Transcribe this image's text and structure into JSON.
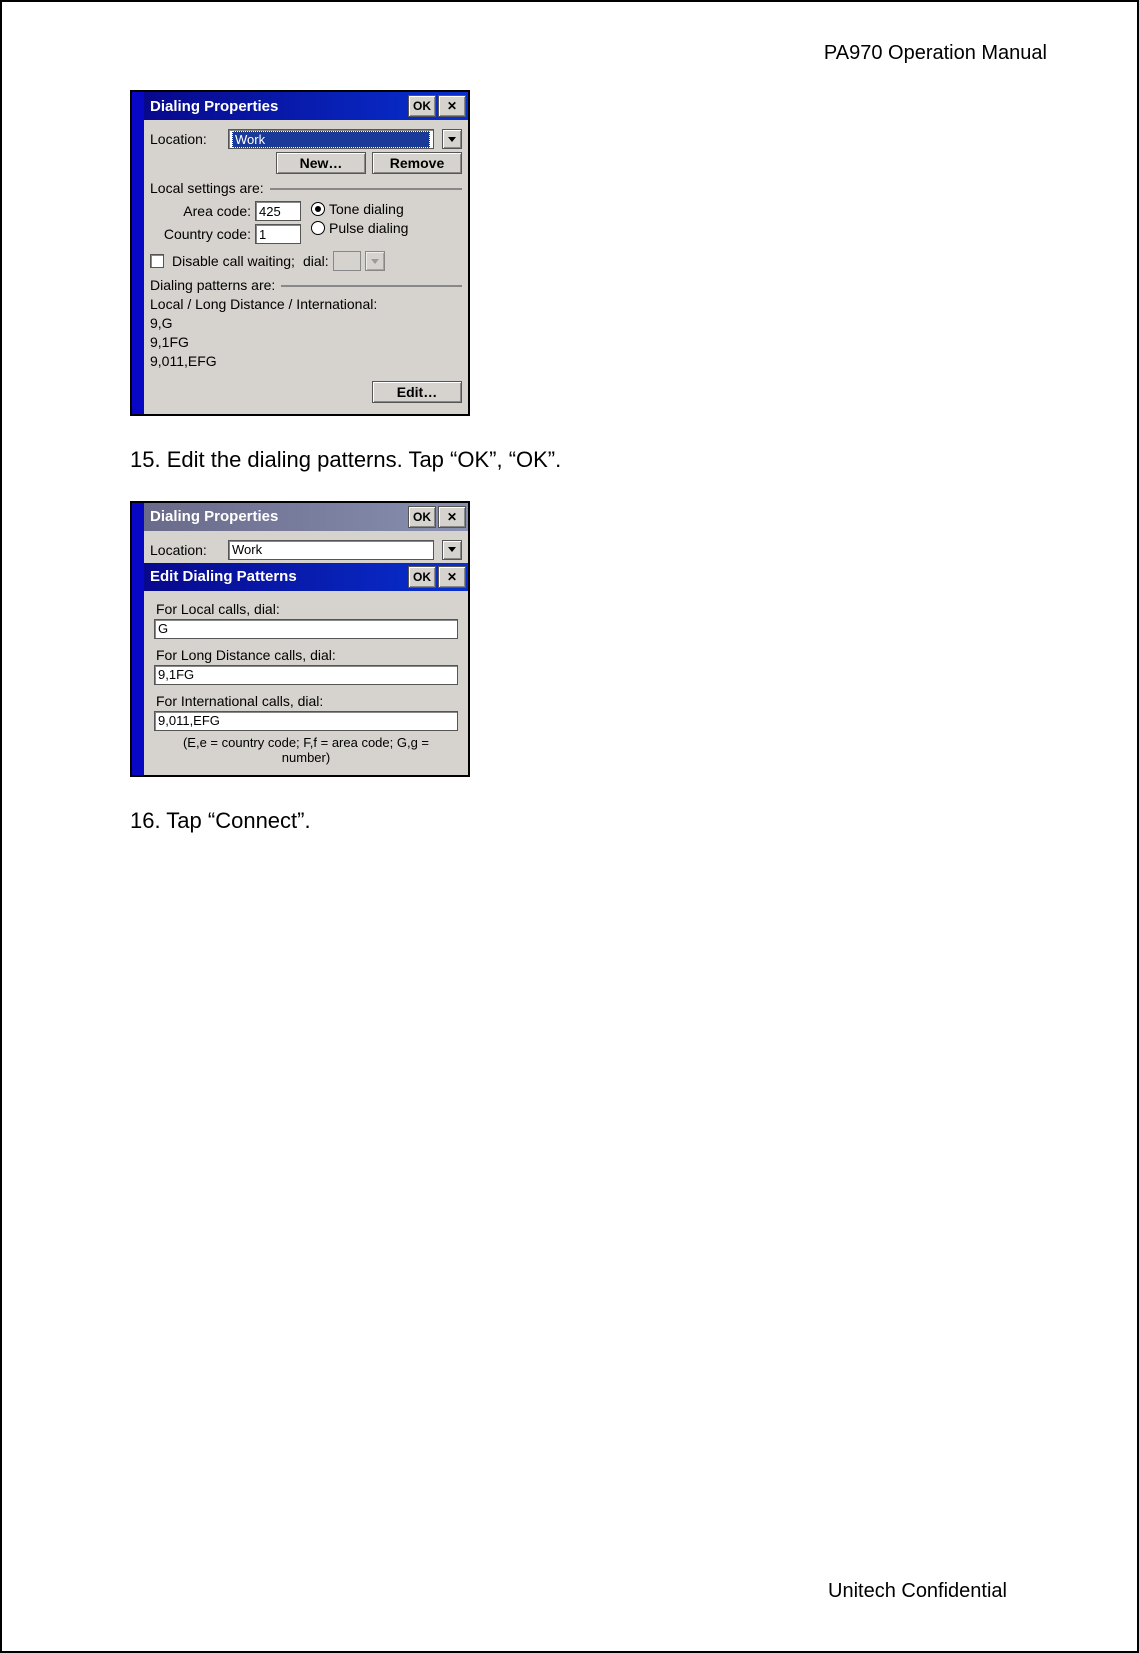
{
  "doc": {
    "header": "PA970 Operation Manual",
    "footer": "Unitech Confidential",
    "step15": "15. Edit the dialing patterns. Tap “OK”, “OK”.",
    "step16": "16. Tap “Connect”."
  },
  "dialog1": {
    "title": "Dialing Properties",
    "ok": "OK",
    "close": "✕",
    "location_label": "Location:",
    "location_value": "Work",
    "new_btn": "New…",
    "remove_btn": "Remove",
    "local_settings_label": "Local settings are:",
    "area_code_label": "Area code:",
    "area_code_value": "425",
    "country_code_label": "Country code:",
    "country_code_value": "1",
    "tone_label": "Tone dialing",
    "pulse_label": "Pulse dialing",
    "disable_call_waiting_label": "Disable call waiting;",
    "dial_label": "dial:",
    "patterns_label": "Dialing patterns are:",
    "patterns_sublabel": "Local / Long Distance / International:",
    "pattern_local": "9,G",
    "pattern_long": "9,1FG",
    "pattern_intl": "9,011,EFG",
    "edit_btn": "Edit…"
  },
  "dialog2": {
    "parent_title": "Dialing Properties",
    "parent_ok": "OK",
    "parent_close": "✕",
    "parent_location_label": "Location:",
    "parent_location_value": "Work",
    "child_title": "Edit Dialing Patterns",
    "child_ok": "OK",
    "child_close": "✕",
    "local_label": "For Local calls, dial:",
    "local_value": "G",
    "long_label": "For Long Distance calls, dial:",
    "long_value": "9,1FG",
    "intl_label": "For International calls, dial:",
    "intl_value": "9,011,EFG",
    "hint": "(E,e = country code; F,f = area code; G,g = number)"
  }
}
